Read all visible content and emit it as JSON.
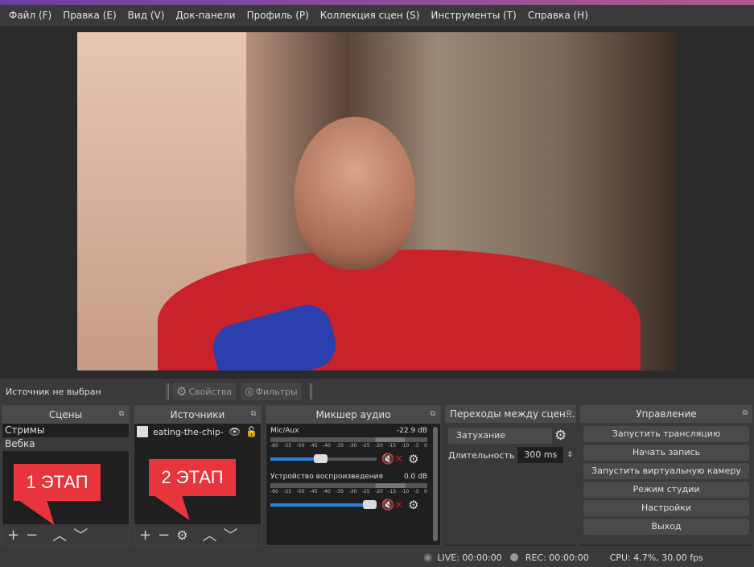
{
  "menu": [
    "Файл (F)",
    "Правка (E)",
    "Вид (V)",
    "Док-панели",
    "Профиль (P)",
    "Коллекция сцен (S)",
    "Инструменты (T)",
    "Справка (H)"
  ],
  "source_bar": {
    "status": "Источник не выбран",
    "properties": "Свойства",
    "filters": "Фильтры"
  },
  "scenes": {
    "title": "Сцены",
    "items": [
      "Стримы",
      "Вебка"
    ],
    "selected": "Вебка"
  },
  "sources": {
    "title": "Источники",
    "items": [
      "eating-the-chip-ch"
    ]
  },
  "callouts": [
    "1 ЭТАП",
    "2 ЭТАП"
  ],
  "mixer": {
    "title": "Микшер аудио",
    "channels": [
      {
        "name": "Mic/Aux",
        "db": "-22.9 dB",
        "volume": 0.47
      },
      {
        "name": "Устройство воспроизведения",
        "db": "0.0 dB",
        "volume": 1.0
      }
    ],
    "ticks": [
      "-60",
      "-55",
      "-50",
      "-45",
      "-40",
      "-35",
      "-30",
      "-25",
      "-20",
      "-15",
      "-10",
      "-5",
      "0"
    ]
  },
  "transitions": {
    "title": "Переходы между сцен...",
    "selected": "Затухание",
    "duration_label": "Длительность",
    "duration": "300 ms"
  },
  "controls": {
    "title": "Управление",
    "buttons": [
      "Запустить трансляцию",
      "Начать запись",
      "Запустить виртуальную камеру",
      "Режим студии",
      "Настройки",
      "Выход"
    ]
  },
  "status": {
    "live": "LIVE: 00:00:00",
    "rec": "REC: 00:00:00",
    "cpu": "CPU: 4.7%, 30.00 fps"
  },
  "colors": {
    "accent": "#2a82da",
    "callout": "#e8343c",
    "mute": "#dd1111"
  }
}
